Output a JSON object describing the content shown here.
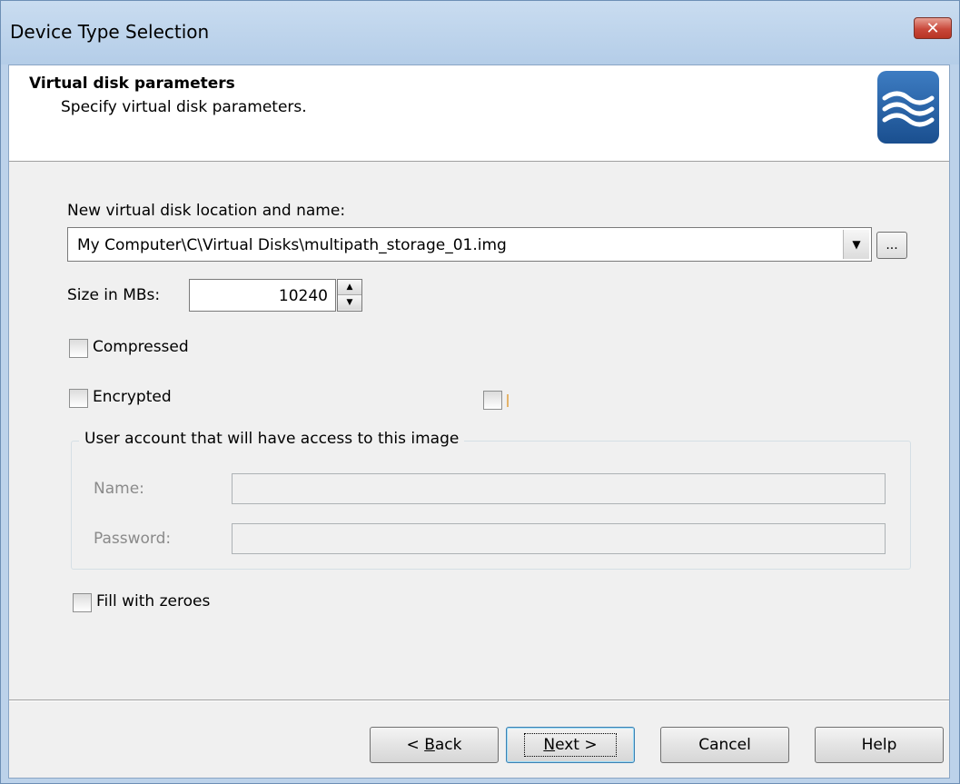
{
  "window": {
    "title": "Device Type Selection",
    "close_label": "✕"
  },
  "header": {
    "title": "Virtual disk parameters",
    "subtitle": "Specify virtual disk parameters."
  },
  "form": {
    "location_label": "New virtual disk location and name:",
    "location_value": "My Computer\\C\\Virtual Disks\\multipath_storage_01.img",
    "browse_label": "...",
    "size_label": "Size in MBs:",
    "size_value": "10240",
    "compressed_label": "Compressed",
    "encrypted_label": "Encrypted",
    "group_legend": "User account that will have access to this image",
    "name_label": "Name:",
    "password_label": "Password:",
    "fill_zeroes_label": "Fill with zeroes"
  },
  "buttons": {
    "back_prefix": "< ",
    "back_mnemonic": "B",
    "back_rest": "ack",
    "next_mnemonic": "N",
    "next_rest": "ext >",
    "cancel": "Cancel",
    "help": "Help"
  },
  "icons": {
    "close": "close-icon",
    "logo": "waves-logo-icon",
    "dropdown": "chevron-down-icon",
    "spinner_up": "arrow-up-icon",
    "spinner_down": "arrow-down-icon"
  }
}
